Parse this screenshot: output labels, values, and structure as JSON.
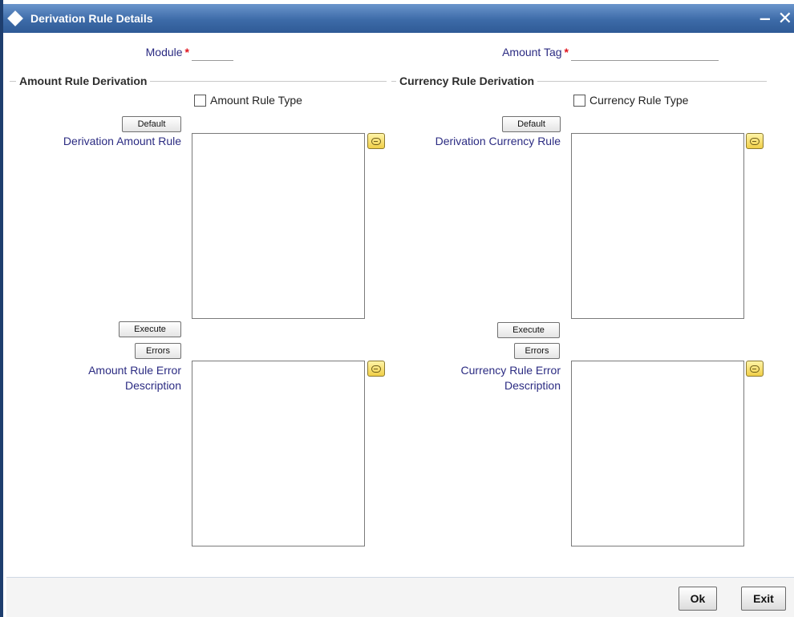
{
  "window": {
    "title": "Derivation Rule Details",
    "minimize_glyph": "‒",
    "close_glyph": "✕"
  },
  "header": {
    "module_label": "Module",
    "module_value": "",
    "amount_tag_label": "Amount Tag",
    "amount_tag_value": "",
    "required_marker": "*"
  },
  "amount_section": {
    "title": "Amount Rule Derivation",
    "checkbox_label": "Amount Rule Type",
    "checkbox_checked": false,
    "default_label": "Default",
    "rule_label": "Derivation Amount Rule",
    "rule_value": "",
    "execute_label": "Execute",
    "errors_label": "Errors",
    "error_label": "Amount Rule Error Description",
    "error_value": ""
  },
  "currency_section": {
    "title": "Currency Rule Derivation",
    "checkbox_label": "Currency Rule Type",
    "checkbox_checked": false,
    "default_label": "Default",
    "rule_label": "Derivation Currency Rule",
    "rule_value": "",
    "execute_label": "Execute",
    "errors_label": "Errors",
    "error_label": "Currency Rule Error Description",
    "error_value": ""
  },
  "footer": {
    "ok_label": "Ok",
    "exit_label": "Exit"
  },
  "icons": {
    "title": "diamond-icon",
    "note": "speech-bubble-icon"
  },
  "colors": {
    "titlebar": "#3d6ba8",
    "label_text": "#2b2b82",
    "required": "#e0141e"
  }
}
